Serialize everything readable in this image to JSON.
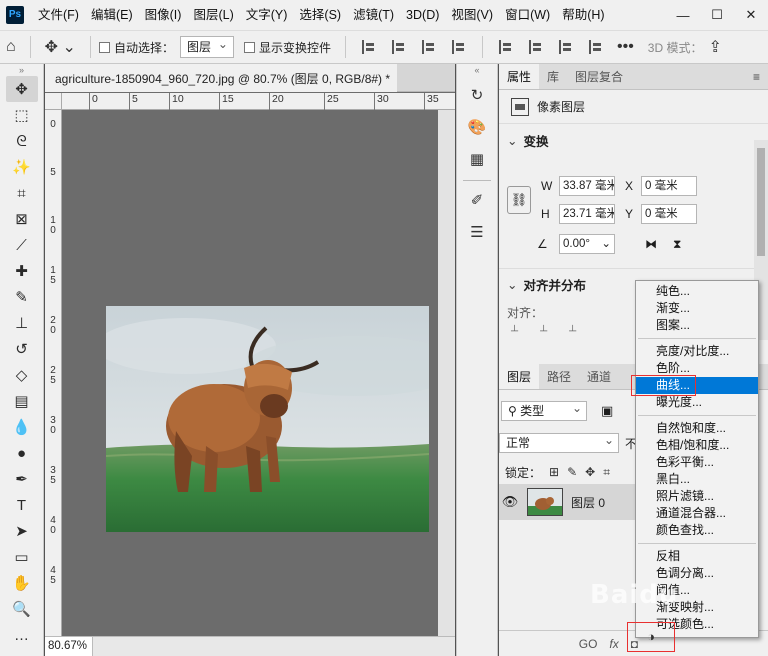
{
  "app": {
    "logo": "Ps"
  },
  "menu": [
    "文件(F)",
    "编辑(E)",
    "图像(I)",
    "图层(L)",
    "文字(Y)",
    "选择(S)",
    "滤镜(T)",
    "3D(D)",
    "视图(V)",
    "窗口(W)",
    "帮助(H)"
  ],
  "window_controls": {
    "minimize": "—",
    "maximize": "☐",
    "close": "✕"
  },
  "options": {
    "auto_select_label": "自动选择：",
    "auto_select_target": "图层",
    "show_transform_label": "显示变换控件",
    "mode_3d": "3D 模式："
  },
  "document": {
    "tab_title": "agriculture-1850904_960_720.jpg @ 80.7% (图层 0, RGB/8#) *",
    "tab_close": "×",
    "ruler_h": [
      "0",
      "5",
      "10",
      "15",
      "20",
      "25",
      "30",
      "35"
    ],
    "ruler_v": [
      "0",
      "5",
      "10",
      "15",
      "20",
      "25",
      "30",
      "35",
      "40",
      "45"
    ],
    "zoom": "80.67%"
  },
  "properties": {
    "tabs": [
      "属性",
      "库",
      "图层复合"
    ],
    "layer_type": "像素图层",
    "transform_title": "变换",
    "w_label": "W",
    "w_value": "33.87 毫米",
    "h_label": "H",
    "h_value": "23.71 毫米",
    "x_label": "X",
    "x_value": "0 毫米",
    "y_label": "Y",
    "y_value": "0 毫米",
    "angle_value": "0.00°",
    "align_title": "对齐并分布",
    "align_label": "对齐："
  },
  "layers": {
    "tabs": [
      "图层",
      "路径",
      "通道"
    ],
    "filter_kind": "类型",
    "blend_mode": "正常",
    "opacity_label_partial": "不",
    "lock_label": "锁定：",
    "layer_name": "图层 0",
    "bottom_icons": [
      "GO",
      "fx"
    ]
  },
  "adjustment_menu": {
    "groups": [
      [
        "纯色...",
        "渐变...",
        "图案..."
      ],
      [
        "亮度/对比度...",
        "色阶...",
        "曲线...",
        "曝光度..."
      ],
      [
        "自然饱和度...",
        "色相/饱和度...",
        "色彩平衡...",
        "黑白...",
        "照片滤镜...",
        "通道混合器...",
        "颜色查找..."
      ],
      [
        "反相",
        "色调分离...",
        "阈值...",
        "渐变映射...",
        "可选颜色..."
      ]
    ],
    "highlighted": "曲线..."
  },
  "watermark": "Baidu",
  "colors": {
    "accent": "#0078d7",
    "annotation": "#e83030",
    "canvas": "#6c6c6c"
  }
}
